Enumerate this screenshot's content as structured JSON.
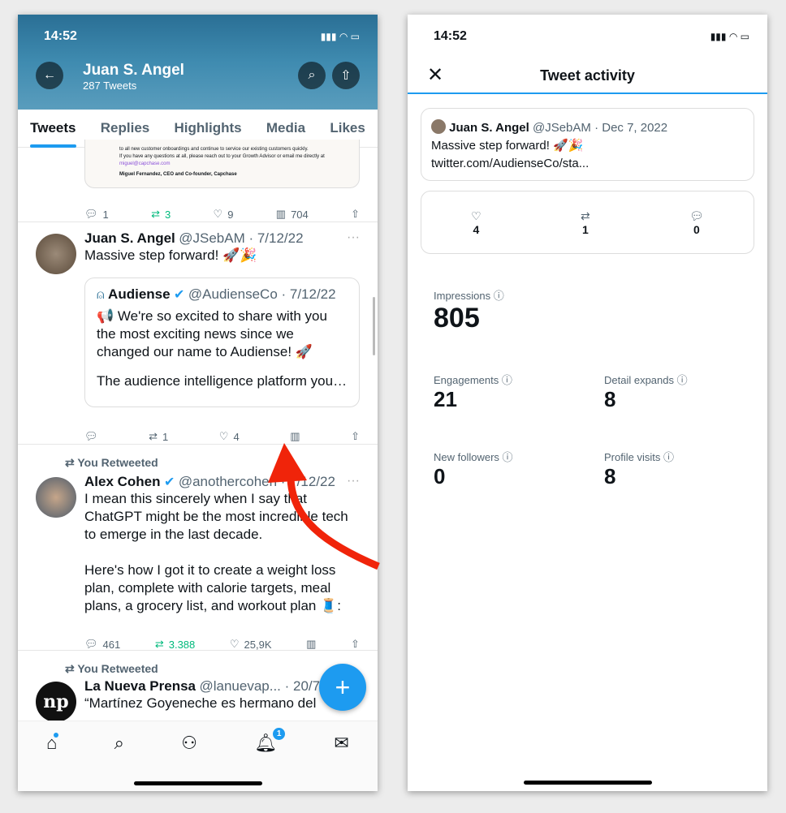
{
  "left": {
    "time": "14:52",
    "profile_name": "Juan S. Angel",
    "tweet_count": "287 Tweets",
    "tabs": [
      "Tweets",
      "Replies",
      "Highlights",
      "Media",
      "Likes"
    ],
    "prev_card": {
      "line1": "to all new customer onboardings and continue to service our existing customers quickly.",
      "line2": "If you have any questions at all, please reach out to your Growth Advisor or email me directly at",
      "email": "miguel@capchase.com",
      "signature": "Miguel Fernandez, CEO and Co-founder, Capchase"
    },
    "prev_actions": {
      "replies": "1",
      "retweets": "3",
      "likes": "9",
      "views": "704"
    },
    "tweet1": {
      "name": "Juan S. Angel",
      "handle": "@JSebAM · 7/12/22",
      "text": "Massive step forward! 🚀🎉",
      "quote": {
        "name": "Audiense",
        "handle": "@AudienseCo · 7/12/22",
        "text1": "📢 We're so excited to share with you the most exciting news since we changed our name to Audiense! 🚀",
        "text2": "The audience intelligence platform you…"
      },
      "actions": {
        "replies": "",
        "retweets": "1",
        "likes": "4",
        "views": ""
      }
    },
    "tweet2": {
      "rt": "You Retweeted",
      "name": "Alex Cohen",
      "handle": "@anothercohen · 7/12/22",
      "text1": "I mean this sincerely when I say that ChatGPT might be the most incredible tech to emerge in the last decade.",
      "text2": "Here's how I got it to create a weight loss plan, complete with calorie targets, meal plans, a grocery list, and workout plan 🧵:",
      "actions": {
        "replies": "461",
        "retweets": "3.388",
        "likes": "25,9K",
        "views": ""
      }
    },
    "tweet3": {
      "rt": "You Retweeted",
      "name": "La Nueva Prensa",
      "handle": "@lanuevap... · 20/7/22",
      "text": "“Martínez Goyeneche es hermano del"
    },
    "notification_badge": "1",
    "fab": "+"
  },
  "right": {
    "time": "14:52",
    "title": "Tweet activity",
    "tweet": {
      "name": "Juan S. Angel",
      "handle": "@JSebAM · Dec 7, 2022",
      "text": "Massive step forward! 🚀🎉",
      "link": "twitter.com/AudienseCo/sta..."
    },
    "counts": {
      "likes": "4",
      "retweets": "1",
      "replies": "0"
    },
    "impressions": {
      "label": "Impressions",
      "value": "805"
    },
    "engagements": {
      "label": "Engagements",
      "value": "21"
    },
    "detail_expands": {
      "label": "Detail expands",
      "value": "8"
    },
    "new_followers": {
      "label": "New followers",
      "value": "0"
    },
    "profile_visits": {
      "label": "Profile visits",
      "value": "8"
    }
  },
  "colors": {
    "accent": "#1d9bf0",
    "retweet": "#00ba7c",
    "arrow": "#f0240a"
  }
}
